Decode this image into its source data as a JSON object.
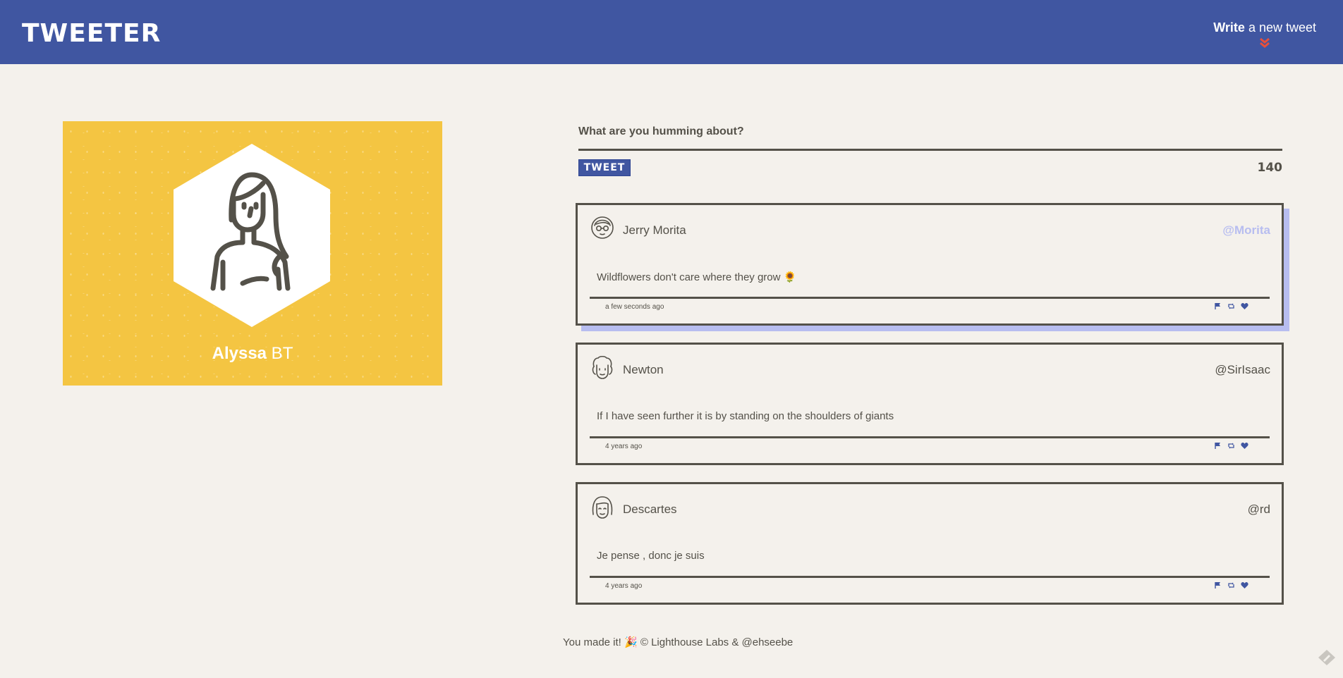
{
  "nav": {
    "brand": "TWEETER",
    "compose_bold": "Write",
    "compose_rest": " a new tweet",
    "chevron_icon": "double-chevron-down-icon",
    "chevron_color": "#e8503a"
  },
  "profile": {
    "first_name": "Alyssa",
    "last_name": " BT",
    "avatar_icon": "woman-avatar-icon",
    "card_color": "#f4c542"
  },
  "compose": {
    "label": "What are you humming about?",
    "input_value": "",
    "button_label": "TWEET",
    "counter": "140"
  },
  "tweets": [
    {
      "name": "Jerry Morita",
      "handle": "@Morita",
      "text": "Wildflowers don't care where they grow 🌻",
      "time": "a few seconds ago",
      "avatar_icon": "glasses-person-avatar-icon"
    },
    {
      "name": "Newton",
      "handle": "@SirIsaac",
      "text": "If I have seen further it is by standing on the shoulders of giants",
      "time": "4 years ago",
      "avatar_icon": "curly-hair-avatar-icon"
    },
    {
      "name": "Descartes",
      "handle": "@rd",
      "text": "Je pense , donc je suis",
      "time": "4 years ago",
      "avatar_icon": "bob-hair-avatar-icon"
    }
  ],
  "actions": {
    "flag_icon": "flag-icon",
    "retweet_icon": "retweet-icon",
    "like_icon": "heart-icon",
    "color": "#4056a1"
  },
  "footer": {
    "text": "You made it! 🎉 © Lighthouse Labs & @ehseebe"
  },
  "colors": {
    "nav": "#4056a1",
    "background": "#f4f1ec",
    "text": "#545149",
    "hover_shadow": "#b7bdf0"
  }
}
